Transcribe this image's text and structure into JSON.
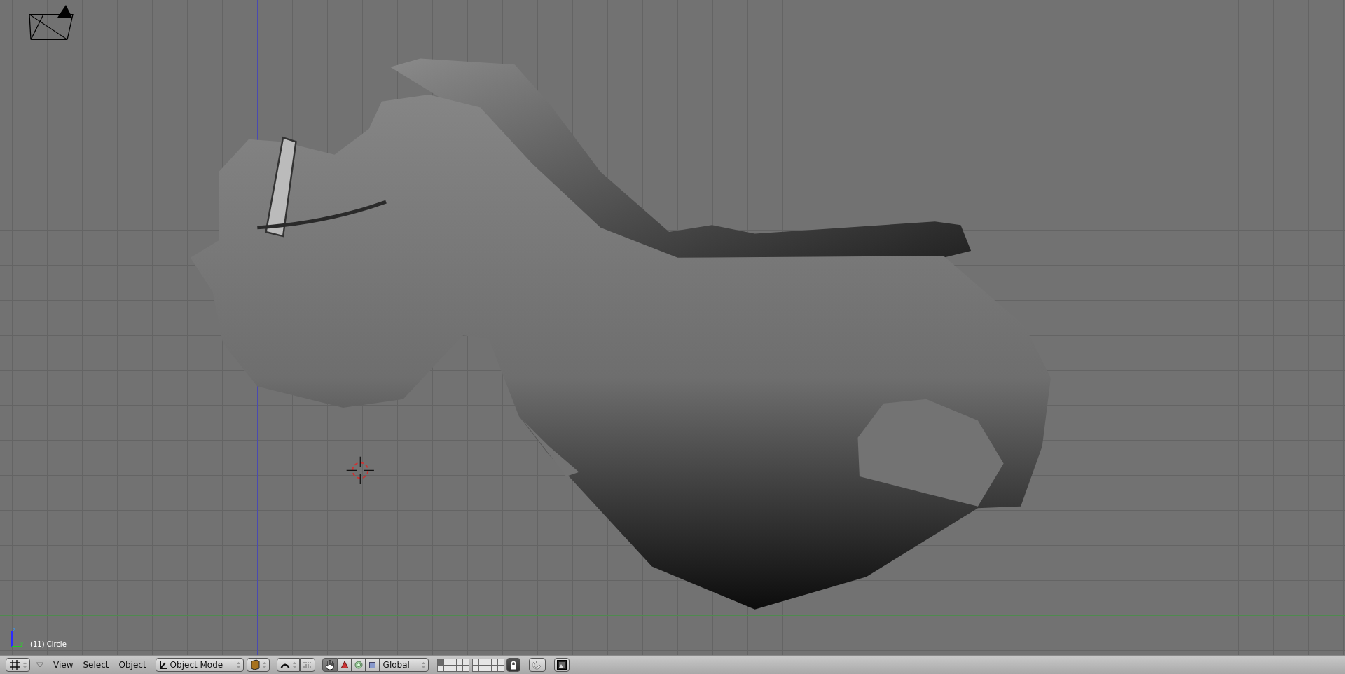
{
  "viewport": {
    "axis_labels": [
      "z",
      "y"
    ],
    "object_info": "(11) Circle"
  },
  "header": {
    "menus": [
      {
        "label": "View"
      },
      {
        "label": "Select"
      },
      {
        "label": "Object"
      }
    ],
    "mode": {
      "value": "Object Mode"
    },
    "manipulator": {
      "on": true
    },
    "orientation": {
      "value": "Global"
    },
    "layers": [
      {
        "selected": true
      },
      {
        "selected": false
      },
      {
        "selected": false
      },
      {
        "selected": false
      },
      {
        "selected": false
      },
      {
        "selected": false
      },
      {
        "selected": false
      },
      {
        "selected": false
      },
      {
        "selected": false
      },
      {
        "selected": false
      },
      {
        "selected": false
      },
      {
        "selected": false
      },
      {
        "selected": false
      },
      {
        "selected": false
      },
      {
        "selected": false
      },
      {
        "selected": false
      },
      {
        "selected": false
      },
      {
        "selected": false
      },
      {
        "selected": false
      },
      {
        "selected": false
      }
    ],
    "lock_layers": {
      "on": true
    }
  }
}
